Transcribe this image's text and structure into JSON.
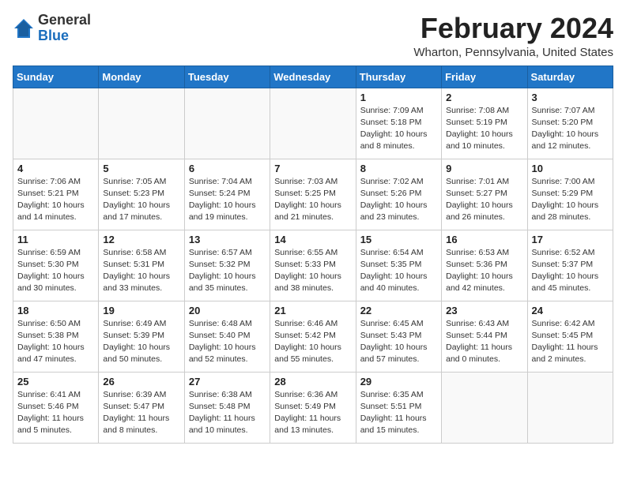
{
  "header": {
    "logo_line1": "General",
    "logo_line2": "Blue",
    "month_title": "February 2024",
    "location": "Wharton, Pennsylvania, United States"
  },
  "days_of_week": [
    "Sunday",
    "Monday",
    "Tuesday",
    "Wednesday",
    "Thursday",
    "Friday",
    "Saturday"
  ],
  "weeks": [
    [
      {
        "day": "",
        "info": ""
      },
      {
        "day": "",
        "info": ""
      },
      {
        "day": "",
        "info": ""
      },
      {
        "day": "",
        "info": ""
      },
      {
        "day": "1",
        "info": "Sunrise: 7:09 AM\nSunset: 5:18 PM\nDaylight: 10 hours\nand 8 minutes."
      },
      {
        "day": "2",
        "info": "Sunrise: 7:08 AM\nSunset: 5:19 PM\nDaylight: 10 hours\nand 10 minutes."
      },
      {
        "day": "3",
        "info": "Sunrise: 7:07 AM\nSunset: 5:20 PM\nDaylight: 10 hours\nand 12 minutes."
      }
    ],
    [
      {
        "day": "4",
        "info": "Sunrise: 7:06 AM\nSunset: 5:21 PM\nDaylight: 10 hours\nand 14 minutes."
      },
      {
        "day": "5",
        "info": "Sunrise: 7:05 AM\nSunset: 5:23 PM\nDaylight: 10 hours\nand 17 minutes."
      },
      {
        "day": "6",
        "info": "Sunrise: 7:04 AM\nSunset: 5:24 PM\nDaylight: 10 hours\nand 19 minutes."
      },
      {
        "day": "7",
        "info": "Sunrise: 7:03 AM\nSunset: 5:25 PM\nDaylight: 10 hours\nand 21 minutes."
      },
      {
        "day": "8",
        "info": "Sunrise: 7:02 AM\nSunset: 5:26 PM\nDaylight: 10 hours\nand 23 minutes."
      },
      {
        "day": "9",
        "info": "Sunrise: 7:01 AM\nSunset: 5:27 PM\nDaylight: 10 hours\nand 26 minutes."
      },
      {
        "day": "10",
        "info": "Sunrise: 7:00 AM\nSunset: 5:29 PM\nDaylight: 10 hours\nand 28 minutes."
      }
    ],
    [
      {
        "day": "11",
        "info": "Sunrise: 6:59 AM\nSunset: 5:30 PM\nDaylight: 10 hours\nand 30 minutes."
      },
      {
        "day": "12",
        "info": "Sunrise: 6:58 AM\nSunset: 5:31 PM\nDaylight: 10 hours\nand 33 minutes."
      },
      {
        "day": "13",
        "info": "Sunrise: 6:57 AM\nSunset: 5:32 PM\nDaylight: 10 hours\nand 35 minutes."
      },
      {
        "day": "14",
        "info": "Sunrise: 6:55 AM\nSunset: 5:33 PM\nDaylight: 10 hours\nand 38 minutes."
      },
      {
        "day": "15",
        "info": "Sunrise: 6:54 AM\nSunset: 5:35 PM\nDaylight: 10 hours\nand 40 minutes."
      },
      {
        "day": "16",
        "info": "Sunrise: 6:53 AM\nSunset: 5:36 PM\nDaylight: 10 hours\nand 42 minutes."
      },
      {
        "day": "17",
        "info": "Sunrise: 6:52 AM\nSunset: 5:37 PM\nDaylight: 10 hours\nand 45 minutes."
      }
    ],
    [
      {
        "day": "18",
        "info": "Sunrise: 6:50 AM\nSunset: 5:38 PM\nDaylight: 10 hours\nand 47 minutes."
      },
      {
        "day": "19",
        "info": "Sunrise: 6:49 AM\nSunset: 5:39 PM\nDaylight: 10 hours\nand 50 minutes."
      },
      {
        "day": "20",
        "info": "Sunrise: 6:48 AM\nSunset: 5:40 PM\nDaylight: 10 hours\nand 52 minutes."
      },
      {
        "day": "21",
        "info": "Sunrise: 6:46 AM\nSunset: 5:42 PM\nDaylight: 10 hours\nand 55 minutes."
      },
      {
        "day": "22",
        "info": "Sunrise: 6:45 AM\nSunset: 5:43 PM\nDaylight: 10 hours\nand 57 minutes."
      },
      {
        "day": "23",
        "info": "Sunrise: 6:43 AM\nSunset: 5:44 PM\nDaylight: 11 hours\nand 0 minutes."
      },
      {
        "day": "24",
        "info": "Sunrise: 6:42 AM\nSunset: 5:45 PM\nDaylight: 11 hours\nand 2 minutes."
      }
    ],
    [
      {
        "day": "25",
        "info": "Sunrise: 6:41 AM\nSunset: 5:46 PM\nDaylight: 11 hours\nand 5 minutes."
      },
      {
        "day": "26",
        "info": "Sunrise: 6:39 AM\nSunset: 5:47 PM\nDaylight: 11 hours\nand 8 minutes."
      },
      {
        "day": "27",
        "info": "Sunrise: 6:38 AM\nSunset: 5:48 PM\nDaylight: 11 hours\nand 10 minutes."
      },
      {
        "day": "28",
        "info": "Sunrise: 6:36 AM\nSunset: 5:49 PM\nDaylight: 11 hours\nand 13 minutes."
      },
      {
        "day": "29",
        "info": "Sunrise: 6:35 AM\nSunset: 5:51 PM\nDaylight: 11 hours\nand 15 minutes."
      },
      {
        "day": "",
        "info": ""
      },
      {
        "day": "",
        "info": ""
      }
    ]
  ]
}
